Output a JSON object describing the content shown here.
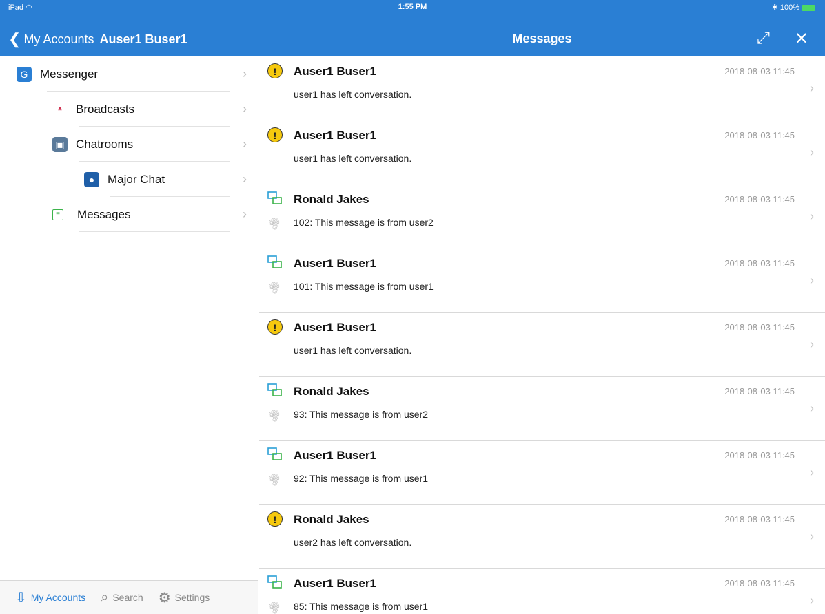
{
  "status": {
    "device": "iPad",
    "time": "1:55 PM",
    "battery": "100%"
  },
  "nav": {
    "back_label": "My Accounts",
    "account_name": "Auser1 Buser1",
    "title": "Messages"
  },
  "colors": {
    "accent": "#2a7fd4",
    "alert": "#f6c90e",
    "chat_icon": "#2a9fd6"
  },
  "sidebar": {
    "items": [
      {
        "label": "Messenger",
        "icon": "messenger-icon"
      },
      {
        "label": "Broadcasts",
        "icon": "broadcast-icon"
      },
      {
        "label": "Chatrooms",
        "icon": "chatrooms-icon"
      },
      {
        "label": "Major Chat",
        "icon": "chatroom-icon"
      },
      {
        "label": "Messages",
        "icon": "messages-icon"
      }
    ],
    "tabs": [
      {
        "label": "My Accounts",
        "icon": "download-icon"
      },
      {
        "label": "Search",
        "icon": "search-icon"
      },
      {
        "label": "Settings",
        "icon": "gear-icon"
      }
    ]
  },
  "messages": [
    {
      "kind": "alert",
      "sender": "Auser1 Buser1",
      "time": "2018-08-03 11:45",
      "text": "user1 has left conversation."
    },
    {
      "kind": "alert",
      "sender": "Auser1 Buser1",
      "time": "2018-08-03 11:45",
      "text": "user1 has left conversation."
    },
    {
      "kind": "chat",
      "sender": "Ronald Jakes",
      "time": "2018-08-03 11:45",
      "text": "102: This message is from user2"
    },
    {
      "kind": "chat",
      "sender": "Auser1 Buser1",
      "time": "2018-08-03 11:45",
      "text": "101: This message is from user1"
    },
    {
      "kind": "alert",
      "sender": "Auser1 Buser1",
      "time": "2018-08-03 11:45",
      "text": "user1 has left conversation."
    },
    {
      "kind": "chat",
      "sender": "Ronald Jakes",
      "time": "2018-08-03 11:45",
      "text": "93: This message is from user2"
    },
    {
      "kind": "chat",
      "sender": "Auser1 Buser1",
      "time": "2018-08-03 11:45",
      "text": "92: This message is from user1"
    },
    {
      "kind": "alert",
      "sender": "Ronald Jakes",
      "time": "2018-08-03 11:45",
      "text": "user2 has left conversation."
    },
    {
      "kind": "chat",
      "sender": "Auser1 Buser1",
      "time": "2018-08-03 11:45",
      "text": "85: This message is from user1"
    }
  ]
}
